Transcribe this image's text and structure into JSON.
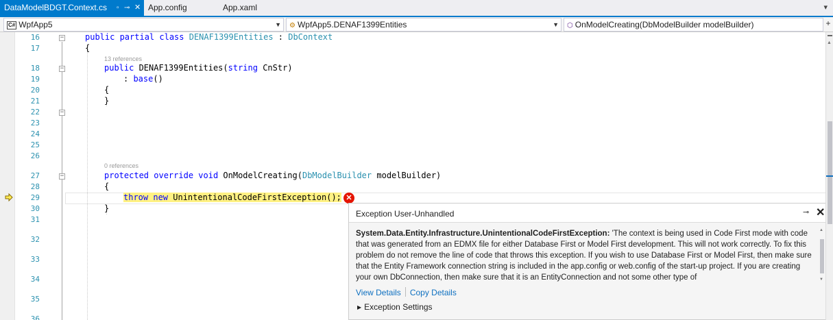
{
  "tabs": [
    {
      "label": "DataModelBDGT.Context.cs",
      "active": true
    },
    {
      "label": "App.config",
      "active": false
    },
    {
      "label": "App.xaml",
      "active": false
    }
  ],
  "navbar": {
    "project": "WpfApp5",
    "project_badge": "C#",
    "type": "WpfApp5.DENAF1399Entities",
    "member": "OnModelCreating(DbModelBuilder modelBuilder)"
  },
  "editor": {
    "line_numbers": [
      "16",
      "17",
      "18",
      "19",
      "20",
      "21",
      "22",
      "23",
      "24",
      "25",
      "26",
      "27",
      "28",
      "29",
      "30",
      "31",
      "32",
      "33",
      "34",
      "35",
      "36"
    ],
    "codelens": [
      "13 references",
      "0 references"
    ],
    "code": {
      "l16_kw": "public partial class ",
      "l16_type": "DENAF1399Entities",
      "l16_sep": " : ",
      "l16_base": "DbContext",
      "l17": "{",
      "l18_kw": "public ",
      "l18_name": "DENAF1399Entities(",
      "l18_kw2": "string ",
      "l18_rest": "CnStr)",
      "l19_pre": ": ",
      "l19_kw": "base",
      "l19_rest": "()",
      "l20": "{",
      "l21": "}",
      "l27_kw": "protected override void ",
      "l27_name": "OnModelCreating(",
      "l27_type": "DbModelBuilder",
      "l27_rest": " modelBuilder)",
      "l28": "{",
      "l29_kw": "throw new ",
      "l29_rest": "UnintentionalCodeFirstException();",
      "l30": "}"
    }
  },
  "exception": {
    "title": "Exception User-Unhandled",
    "type": "System.Data.Entity.Infrastructure.UnintentionalCodeFirstException:",
    "message": " 'The context is being used in Code First mode with code that was generated from an EDMX file for either Database First or Model First development.  This will not work correctly. To fix this problem do not remove the line of code that throws this exception. If you wish to use Database First or Model First, then make sure that the Entity Framework connection string is included in the app.config or web.config of the start-up project. If you are creating your own DbConnection, then make sure that it is an EntityConnection and not some other type of",
    "view_details": "View Details",
    "copy_details": "Copy Details",
    "settings": "Exception Settings"
  }
}
